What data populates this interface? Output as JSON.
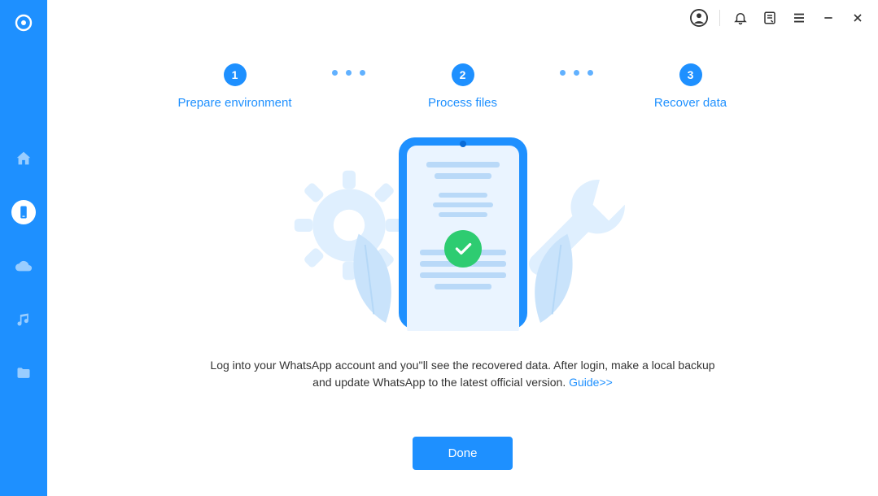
{
  "sidebar": {
    "items": [
      {
        "name": "home"
      },
      {
        "name": "phone",
        "active": true
      },
      {
        "name": "cloud"
      },
      {
        "name": "music"
      },
      {
        "name": "folder"
      }
    ]
  },
  "titlebar": {
    "icons": [
      "account",
      "bell",
      "note",
      "menu",
      "minimize",
      "close"
    ]
  },
  "steps": [
    {
      "num": "1",
      "label": "Prepare environment"
    },
    {
      "num": "2",
      "label": "Process files"
    },
    {
      "num": "3",
      "label": "Recover data"
    }
  ],
  "message": {
    "text": "Log into your WhatsApp account and you''ll see the recovered data. After login, make a local backup and update WhatsApp to the latest official version. ",
    "link_label": "Guide>>"
  },
  "buttons": {
    "done": "Done"
  }
}
